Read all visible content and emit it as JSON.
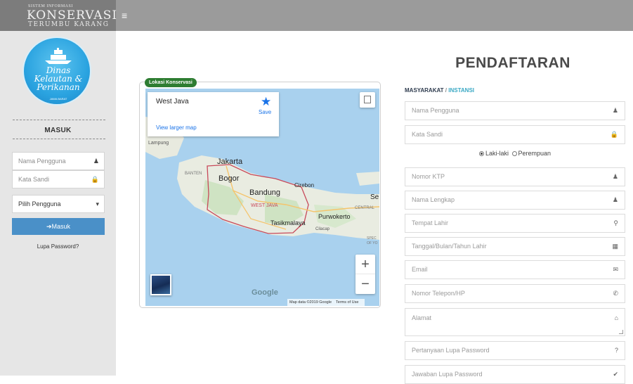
{
  "header": {
    "brand_tiny": "SISTEM INFORMASI",
    "brand_title": "KONSERVASI",
    "brand_subtitle": "TERUMBU KARANG",
    "menu_icon": "hamburger-icon"
  },
  "sidebar": {
    "emblem_text": "Dinas Kelautan & Perikanan",
    "emblem_small": "JAWA BARAT",
    "login_title": "MASUK",
    "username_placeholder": "Nama Pengguna",
    "password_placeholder": "Kata Sandi",
    "user_select_value": "Pilih Pengguna",
    "login_button": "Masuk",
    "forgot_password": "Lupa Password?"
  },
  "map": {
    "section_tag": "Lokasi Konservasi",
    "info_place": "West Java",
    "info_save": "Save",
    "info_larger_map": "View larger map",
    "labels": {
      "lampung": "Lampung",
      "jakarta": "Jakarta",
      "banten": "BANTEN",
      "bogor": "Bogor",
      "bandung": "Bandung",
      "cirebon": "Cirebon",
      "west_java": "WEST JAVA",
      "tasikmalaya": "Tasikmalaya",
      "purwokerto": "Purwokerto",
      "cilacap": "Cilacap",
      "central": "CENTRAL",
      "se": "Se",
      "spec": "SPEC",
      "ofyo": "OF YO"
    },
    "google_logo": "Google",
    "attribution": "Map data ©2019 Google",
    "terms": "Terms of Use",
    "zoom_in": "+",
    "zoom_out": "−"
  },
  "registration": {
    "title": "PENDAFTARAN",
    "tab_public": "MASYARAKAT",
    "tab_separator": "/",
    "tab_institution": "INSTANSI",
    "gender_male": "Laki-laki",
    "gender_female": "Perempuan",
    "fields": {
      "username": "Nama Pengguna",
      "password": "Kata Sandi",
      "ktp": "Nomor KTP",
      "full_name": "Nama Lengkap",
      "birth_place": "Tempat Lahir",
      "birth_date": "Tanggal/Bulan/Tahun Lahir",
      "email": "Email",
      "phone": "Nomor Telepon/HP",
      "address": "Alamat",
      "security_question": "Pertanyaan Lupa Password",
      "security_answer": "Jawaban Lupa Password"
    }
  },
  "colors": {
    "header_bg": "#9b9b9b",
    "login_button": "#4a90c8",
    "tab_active": "#39a8c4",
    "map_tag": "#2e7d32"
  }
}
